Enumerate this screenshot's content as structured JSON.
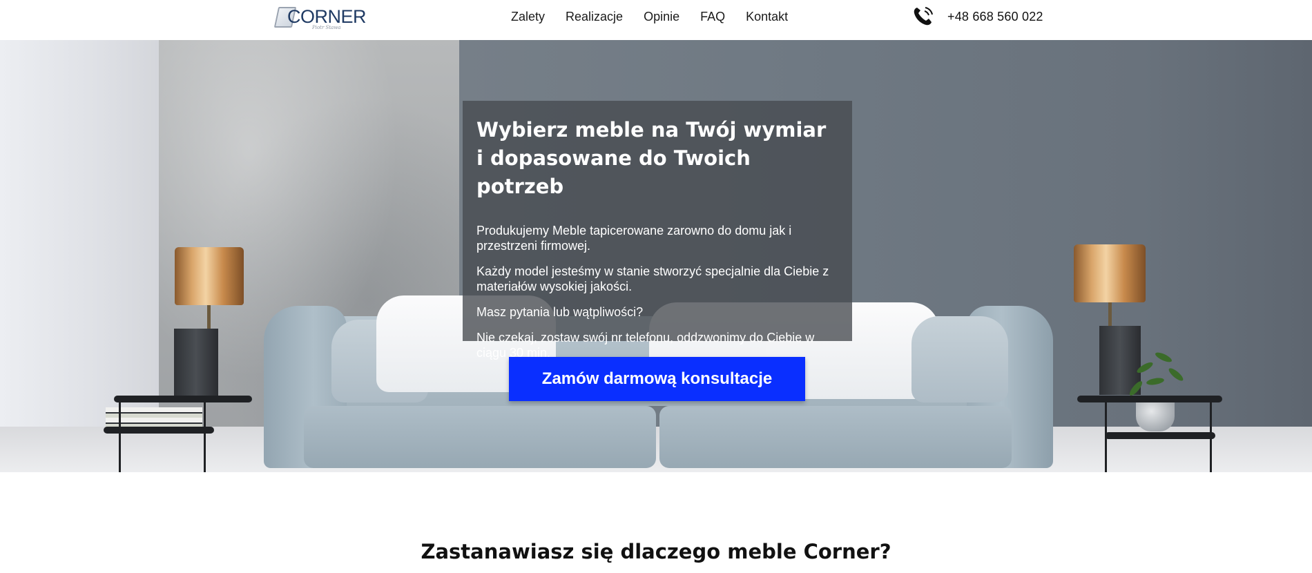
{
  "brand": {
    "logo_text": "CORNER",
    "logo_subtext": "Piotr Stawa"
  },
  "nav": {
    "items": [
      "Zalety",
      "Realizacje",
      "Opinie",
      "FAQ",
      "Kontakt"
    ]
  },
  "contact": {
    "phone": "+48 668 560 022"
  },
  "hero": {
    "title": "Wybierz meble na Twój wymiar i dopasowane do Twoich potrzeb",
    "paragraphs": [
      "Produkujemy Meble tapicerowane zarowno do domu jak i przestrzeni firmowej.",
      "Każdy model jesteśmy w stanie stworzyć specjalnie dla Ciebie z materiałów wysokiej jakości.",
      "Masz pytania lub wątpliwości?",
      "Nie czekaj, zostaw swój nr telefonu, oddzwonimy do Ciebie w ciągu 30 min."
    ],
    "cta_label": "Zamów darmową konsultacje"
  },
  "section": {
    "title": "Zastanawiasz się dlaczego meble Corner?"
  },
  "colors": {
    "cta_background": "#0a2fff",
    "card_overlay": "rgba(70,74,80,0.78)",
    "logo": "#1f3a63"
  },
  "icons": {
    "phone": "phone-icon"
  }
}
